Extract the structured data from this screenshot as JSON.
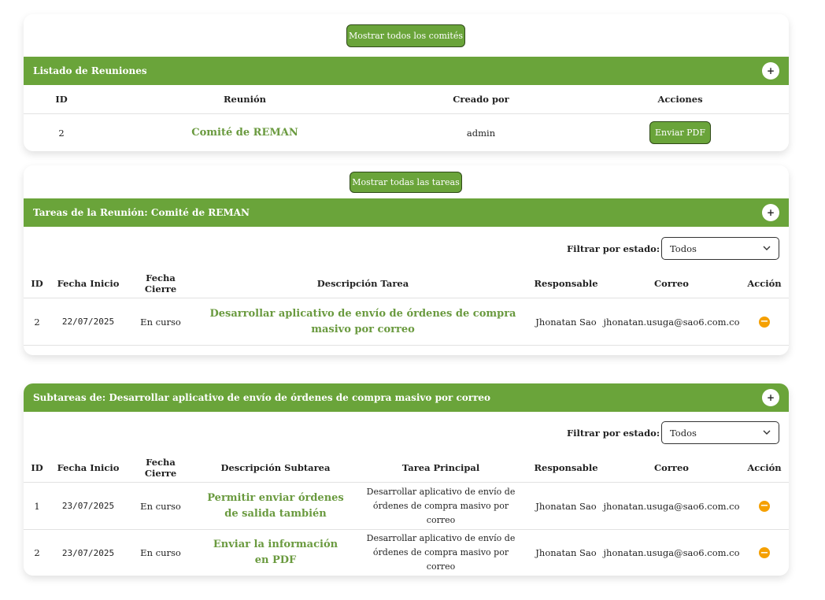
{
  "colors": {
    "accent": "#6aa43a",
    "action": "#f5a000",
    "link": "#6a9a3f"
  },
  "meetings": {
    "show_all_button": "Mostrar todos los comités",
    "header_title": "Listado de Reuniones",
    "expand_icon": "plus-icon",
    "columns": [
      "ID",
      "Reunión",
      "Creado por",
      "Acciones"
    ],
    "rows": [
      {
        "id": "2",
        "name": "Comité de REMAN",
        "created_by": "admin",
        "action": "Enviar PDF"
      }
    ]
  },
  "tasks": {
    "show_all_button": "Mostrar todas las tareas",
    "header_title": "Tareas de la Reunión: Comité de REMAN",
    "filter_label": "Filtrar por estado:",
    "filter_value": "Todos",
    "columns": [
      "ID",
      "Fecha Inicio",
      "Fecha Cierre",
      "Descripción Tarea",
      "Responsable",
      "Correo",
      "Acción"
    ],
    "rows": [
      {
        "id": "2",
        "start": "22/07/2025",
        "end": "En curso",
        "description": "Desarrollar aplicativo de envío de órdenes de compra masivo por correo",
        "responsible": "Jhonatan Sao",
        "email": "jhonatan.usuga@sao6.com.co",
        "action_icon": "minus-circle-icon"
      }
    ]
  },
  "subtasks": {
    "header_title": "Subtareas de: Desarrollar aplicativo de envío de órdenes de compra masivo por correo",
    "filter_label": "Filtrar por estado:",
    "filter_value": "Todos",
    "columns": [
      "ID",
      "Fecha Inicio",
      "Fecha Cierre",
      "Descripción Subtarea",
      "Tarea Principal",
      "Responsable",
      "Correo",
      "Acción"
    ],
    "rows": [
      {
        "id": "1",
        "start": "23/07/2025",
        "end": "En curso",
        "description": "Permitir enviar órdenes de salida también",
        "parent": "Desarrollar aplicativo de envío de órdenes de compra masivo por correo",
        "responsible": "Jhonatan Sao",
        "email": "jhonatan.usuga@sao6.com.co",
        "action_icon": "minus-circle-icon"
      },
      {
        "id": "2",
        "start": "23/07/2025",
        "end": "En curso",
        "description": "Enviar la información en PDF",
        "parent": "Desarrollar aplicativo de envío de órdenes de compra masivo por correo",
        "responsible": "Jhonatan Sao",
        "email": "jhonatan.usuga@sao6.com.co",
        "action_icon": "minus-circle-icon"
      }
    ]
  }
}
